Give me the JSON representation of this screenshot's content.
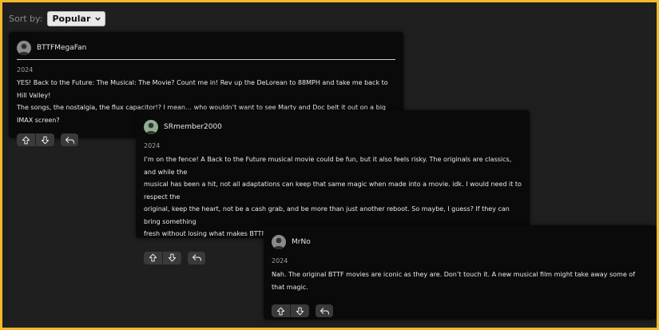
{
  "sort": {
    "label": "Sort by:",
    "selected": "Popular"
  },
  "colors": {
    "frame": "#f5b82a",
    "background": "#1f1f1f",
    "card": "#0a0a0a",
    "button": "#3a3a3a"
  },
  "comments": [
    {
      "username": "BTTFMegaFan",
      "avatar_color": "#8a8a8a",
      "year": "2024",
      "lines": [
        "YES! Back to the Future: The Musical: The Movie? Count me in! Rev up the DeLorean to 88MPH and take me back to Hill Valley!",
        "The songs, the nostalgia, the flux capacitor!? I mean… who wouldn’t want to see Marty and Doc belt it out on a big IMAX screen?"
      ]
    },
    {
      "username": "SRmember2000",
      "avatar_color": "#8fae8f",
      "year": "2024",
      "lines": [
        "I’m on the fence! A Back to the Future musical movie could be fun, but it also feels risky. The originals are classics, and while the",
        "musical has been a hit, not all adaptations can keep that same magic when made into a movie. idk. I would need it to respect the",
        "original, keep the heart, not be a cash grab, and be more than just another reboot. So maybe, I guess? If they can bring something",
        "fresh without losing what makes BTTF legendary, I’m all in. Just would need to see more, I guess."
      ]
    },
    {
      "username": "MrNo",
      "avatar_color": "#8a8a8a",
      "year": "2024",
      "lines": [
        "Nah. The original BTTF movies are iconic as they are. Don’t touch it. A new musical film might take away some of that magic."
      ]
    }
  ]
}
